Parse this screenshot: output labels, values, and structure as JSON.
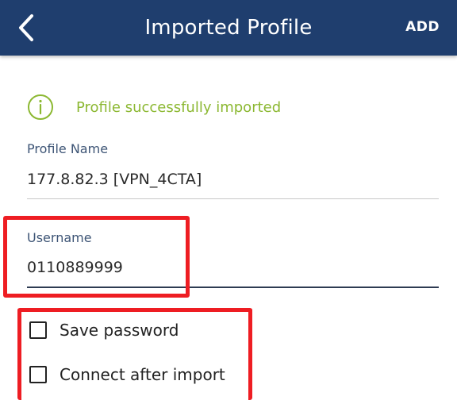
{
  "app_bar": {
    "title": "Imported Profile",
    "add_label": "ADD",
    "background_color": "#1f3e6e"
  },
  "notice": {
    "icon": "info-icon",
    "text": "Profile successfully imported",
    "color": "#8cb832"
  },
  "fields": {
    "profile_name": {
      "label": "Profile Name",
      "value": "177.8.82.3 [VPN_4CTA]"
    },
    "username": {
      "label": "Username",
      "value": "0110889999"
    }
  },
  "checkboxes": {
    "save_password": {
      "label": "Save password",
      "checked": false
    },
    "connect_after_import": {
      "label": "Connect after import",
      "checked": false
    }
  },
  "annotation_color": "#ee1d23"
}
